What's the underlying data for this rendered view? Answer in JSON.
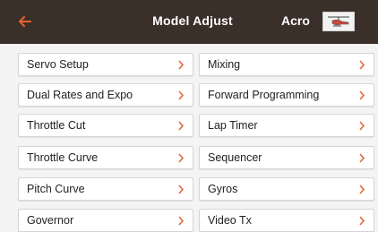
{
  "header": {
    "title": "Model Adjust",
    "mode": "Acro",
    "back_icon": "back-arrow-icon",
    "model_icon": "helicopter-icon"
  },
  "colors": {
    "header_bg": "#3b2f2a",
    "accent": "#e8622c",
    "chevron": "#e2683a"
  },
  "menu": {
    "left": [
      {
        "label": "Servo Setup"
      },
      {
        "label": "Dual Rates and Expo"
      },
      {
        "label": "Throttle Cut"
      },
      {
        "label": "Throttle Curve"
      },
      {
        "label": "Pitch Curve"
      },
      {
        "label": "Governor"
      }
    ],
    "right": [
      {
        "label": "Mixing"
      },
      {
        "label": "Forward Programming"
      },
      {
        "label": "Lap Timer"
      },
      {
        "label": "Sequencer"
      },
      {
        "label": "Gyros"
      },
      {
        "label": "Video Tx"
      }
    ]
  }
}
